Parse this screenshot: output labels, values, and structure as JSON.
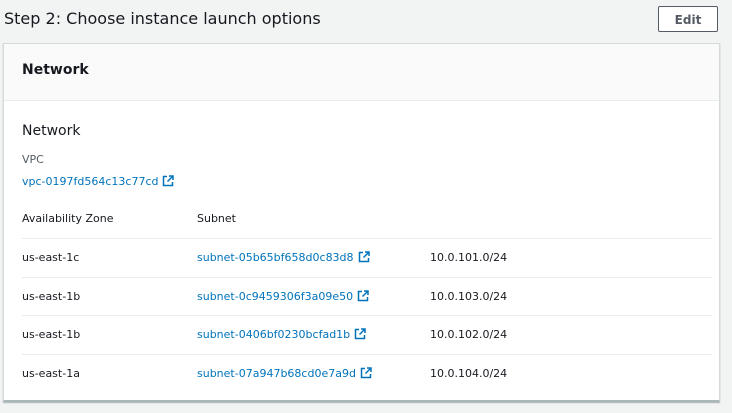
{
  "step": {
    "title": "Step 2: Choose instance launch options",
    "edit_label": "Edit"
  },
  "panel": {
    "title": "Network"
  },
  "network": {
    "section_title": "Network",
    "vpc_label": "VPC",
    "vpc_id": "vpc-0197fd564c13c77cd",
    "columns": {
      "az": "Availability Zone",
      "subnet": "Subnet"
    },
    "rows": [
      {
        "az": "us-east-1c",
        "subnet": "subnet-05b65bf658d0c83d8",
        "cidr": "10.0.101.0/24"
      },
      {
        "az": "us-east-1b",
        "subnet": "subnet-0c9459306f3a09e50",
        "cidr": "10.0.103.0/24"
      },
      {
        "az": "us-east-1b",
        "subnet": "subnet-0406bf0230bcfad1b",
        "cidr": "10.0.102.0/24"
      },
      {
        "az": "us-east-1a",
        "subnet": "subnet-07a947b68cd0e7a9d",
        "cidr": "10.0.104.0/24"
      }
    ]
  },
  "icons": {
    "external_link": "external-link-icon"
  },
  "colors": {
    "link": "#0073bb",
    "text": "#16191f",
    "muted": "#545b64",
    "divider": "#eaeded"
  }
}
